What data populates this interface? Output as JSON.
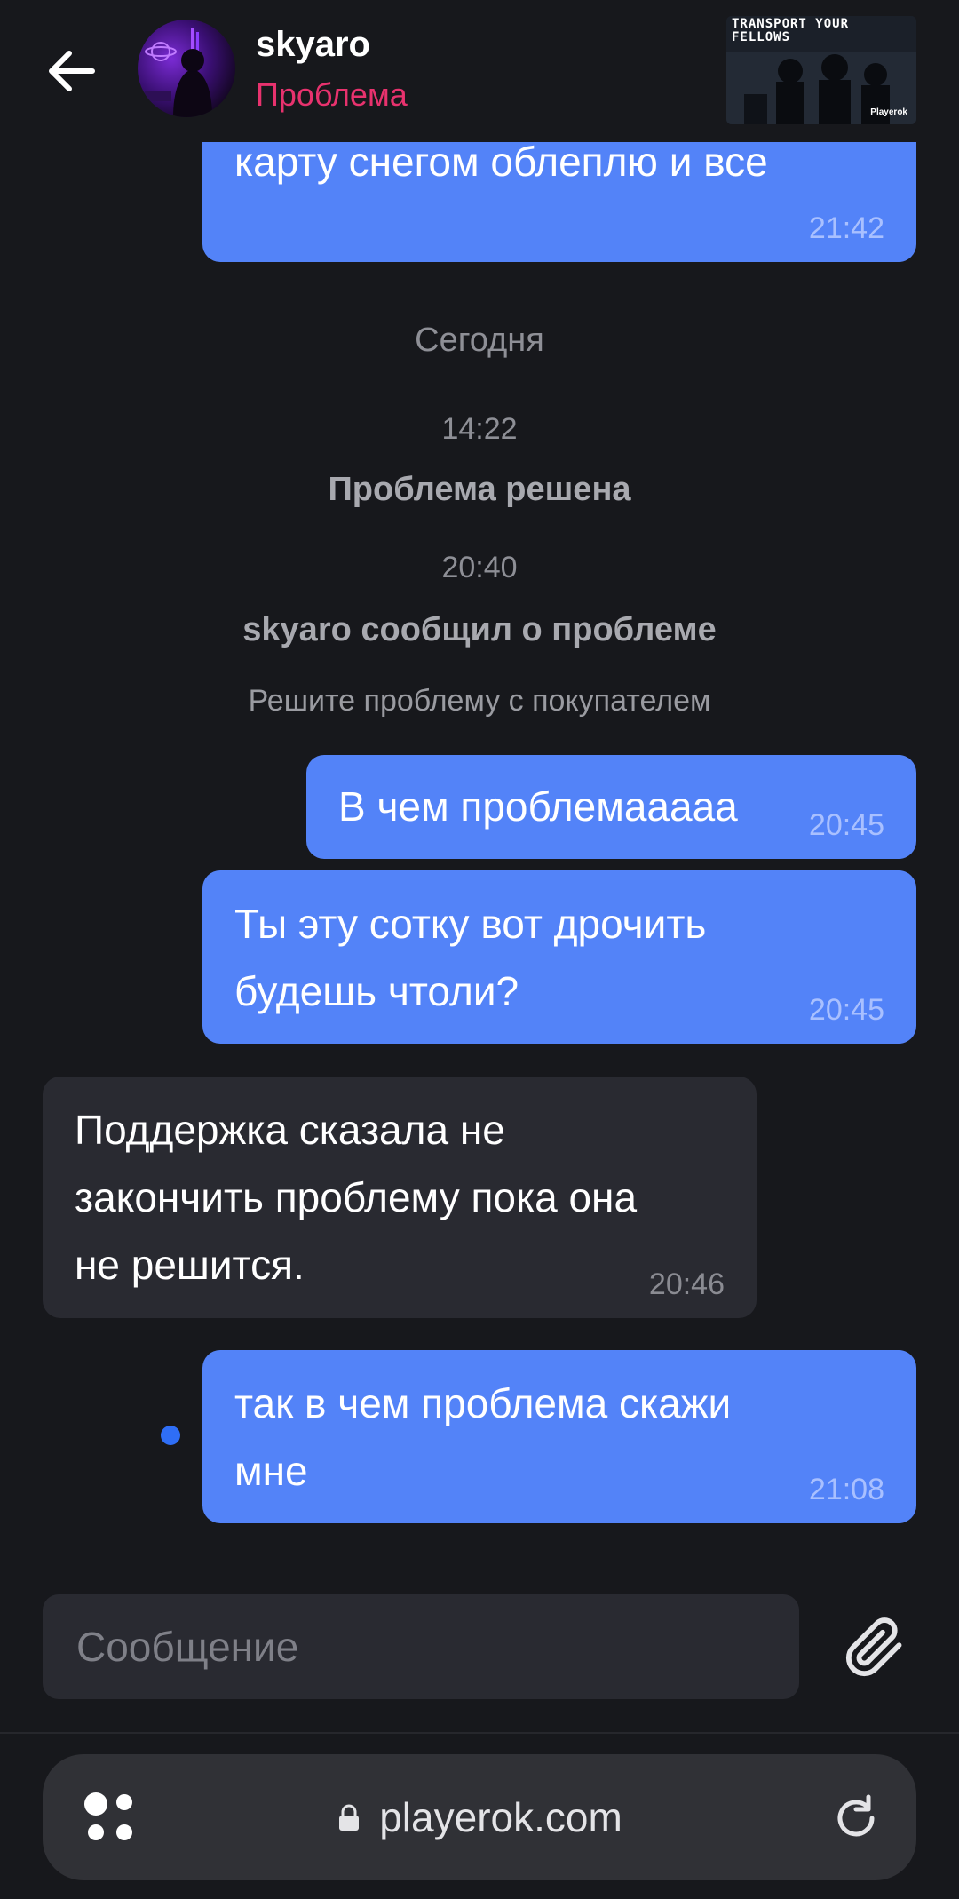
{
  "header": {
    "user_name": "skyaro",
    "status": "Проблема",
    "product_title": "TRANSPORT YOUR FELLOWS",
    "product_brand": "Playerok"
  },
  "messages": {
    "m0": {
      "text": "карту снегом облеплю и все",
      "time": "21:42"
    },
    "date_separator": "Сегодня",
    "sys1_time": "14:22",
    "sys1_title": "Проблема решена",
    "sys2_time": "20:40",
    "sys2_title": "skyaro сообщил о проблеме",
    "sys2_sub": "Решите проблему с покупателем",
    "m1": {
      "text": "В чем проблемааааа",
      "time": "20:45"
    },
    "m2": {
      "line1": "Ты эту сотку вот дрочить",
      "line2": "будешь чтоли?",
      "time": "20:45"
    },
    "m3": {
      "line1": "Поддержка сказала не",
      "line2": "закончить проблему пока она",
      "line3": "не решится.",
      "time": "20:46"
    },
    "m4": {
      "line1": "так в чем проблема скажи",
      "line2": "мне",
      "time": "21:08"
    }
  },
  "composer": {
    "placeholder": "Сообщение"
  },
  "browser": {
    "url": "playerok.com"
  },
  "colors": {
    "outgoing": "#5383f8",
    "incoming": "#292a31",
    "status": "#e8326e",
    "background": "#17181c"
  }
}
